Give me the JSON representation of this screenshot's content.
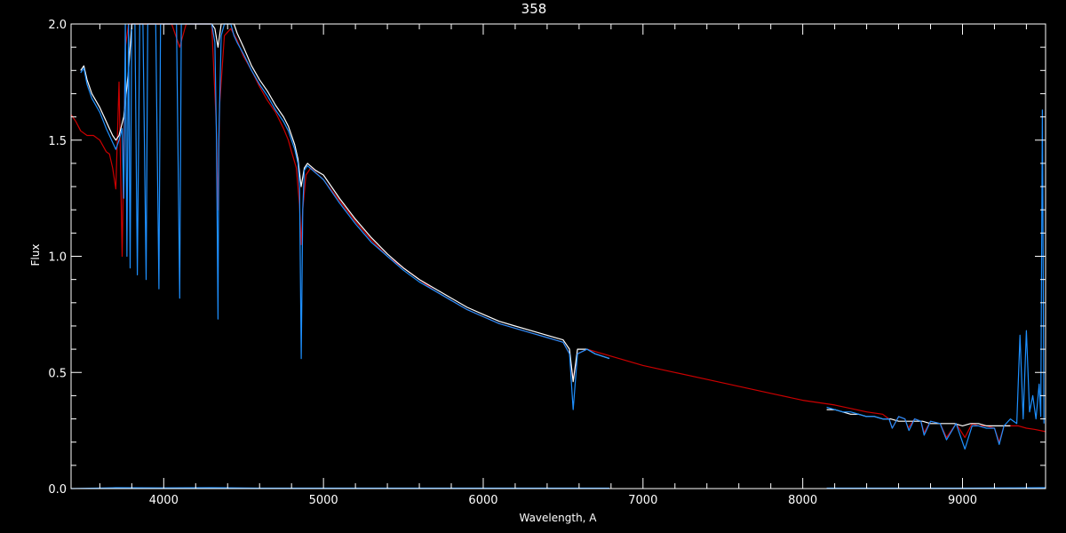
{
  "chart_data": {
    "type": "line",
    "title": "358",
    "xlabel": "Wavelength, A",
    "ylabel": "Flux",
    "xlim": [
      3420,
      9520
    ],
    "ylim": [
      0.0,
      2.0
    ],
    "grid": false,
    "x_ticks": [
      {
        "value": 4000,
        "label": "4000"
      },
      {
        "value": 5000,
        "label": "5000"
      },
      {
        "value": 6000,
        "label": "6000"
      },
      {
        "value": 7000,
        "label": "7000"
      },
      {
        "value": 8000,
        "label": "8000"
      },
      {
        "value": 9000,
        "label": "9000"
      }
    ],
    "y_ticks": [
      {
        "value": 0.0,
        "label": "0.0"
      },
      {
        "value": 0.5,
        "label": "0.5"
      },
      {
        "value": 1.0,
        "label": "1.0"
      },
      {
        "value": 1.5,
        "label": "1.5"
      },
      {
        "value": 2.0,
        "label": "2.0"
      }
    ],
    "colors": {
      "axes": "#ffffff",
      "observed": "#ffffff",
      "corrected": "#1e90ff",
      "model": "#cc0000",
      "error": "#1e90ff"
    },
    "series": [
      {
        "color": "#cc0000",
        "x": [
          3420,
          3450,
          3480,
          3520,
          3560,
          3600,
          3640,
          3660,
          3680,
          3700,
          3720,
          3740,
          3760,
          3780,
          3800,
          3830,
          3850,
          3880,
          3900,
          3940,
          3970,
          3990,
          4010,
          4050,
          4100,
          4140,
          4200,
          4260,
          4300,
          4330,
          4340,
          4350,
          4380,
          4420,
          4460,
          4500,
          4550,
          4600,
          4650,
          4700,
          4750,
          4780,
          4800,
          4830,
          4850,
          4860,
          4870,
          4890,
          4920,
          5000,
          5100,
          5200,
          5300,
          5400,
          5500,
          5600,
          5700,
          5800,
          5900,
          6000,
          6100,
          6200,
          6300,
          6400,
          6500,
          6540,
          6563,
          6590,
          6650,
          6800,
          7000,
          7200,
          7400,
          7600,
          7800,
          8000,
          8200,
          8400,
          8500,
          8540,
          8560,
          8600,
          8640,
          8660,
          8700,
          8740,
          8760,
          8800,
          8860,
          8900,
          8960,
          9015,
          9060,
          9100,
          9150,
          9200,
          9230,
          9260,
          9300,
          9350,
          9400,
          9450,
          9520
        ],
        "values": [
          1.61,
          1.58,
          1.54,
          1.52,
          1.52,
          1.5,
          1.45,
          1.44,
          1.38,
          1.29,
          1.75,
          1.0,
          1.9,
          2.0,
          2.0,
          2.0,
          2.0,
          2.0,
          2.0,
          2.0,
          2.0,
          2.0,
          2.0,
          2.0,
          1.9,
          2.0,
          2.0,
          2.0,
          2.0,
          1.55,
          1.2,
          1.65,
          1.95,
          1.98,
          1.93,
          1.86,
          1.8,
          1.73,
          1.67,
          1.62,
          1.55,
          1.5,
          1.45,
          1.38,
          1.22,
          1.05,
          1.2,
          1.35,
          1.38,
          1.33,
          1.24,
          1.15,
          1.07,
          1.0,
          0.95,
          0.9,
          0.85,
          0.81,
          0.77,
          0.74,
          0.71,
          0.69,
          0.67,
          0.65,
          0.63,
          0.58,
          0.47,
          0.58,
          0.6,
          0.57,
          0.53,
          0.5,
          0.47,
          0.44,
          0.41,
          0.38,
          0.36,
          0.33,
          0.32,
          0.3,
          0.26,
          0.31,
          0.3,
          0.26,
          0.3,
          0.29,
          0.24,
          0.29,
          0.28,
          0.22,
          0.28,
          0.22,
          0.28,
          0.27,
          0.27,
          0.26,
          0.2,
          0.27,
          0.27,
          0.27,
          0.26,
          0.255,
          0.245
        ]
      },
      {
        "color": "#ffffff",
        "x": [
          3480,
          3500,
          3520,
          3550,
          3600,
          3640,
          3660,
          3680,
          3700,
          3720,
          3750,
          3780,
          3800,
          3850,
          3900,
          3950,
          4000,
          4050,
          4100,
          4150,
          4200,
          4250,
          4280,
          4300,
          4320,
          4340,
          4360,
          4380,
          4400,
          4420,
          4440,
          4460,
          4500,
          4550,
          4600,
          4650,
          4700,
          4750,
          4780,
          4800,
          4820,
          4840,
          4860,
          4880,
          4900,
          4950,
          5000,
          5100,
          5200,
          5300,
          5400,
          5500,
          5600,
          5700,
          5800,
          5900,
          6000,
          6100,
          6200,
          6300,
          6400,
          6500,
          6540,
          6563,
          6590,
          6650,
          6700,
          6790
        ],
        "values": [
          1.8,
          1.82,
          1.76,
          1.7,
          1.64,
          1.58,
          1.55,
          1.52,
          1.5,
          1.52,
          1.6,
          1.8,
          2.0,
          2.0,
          2.0,
          2.0,
          2.0,
          2.0,
          2.0,
          2.0,
          2.0,
          2.0,
          2.0,
          2.0,
          1.98,
          1.9,
          2.0,
          2.05,
          2.1,
          2.05,
          2.0,
          1.96,
          1.9,
          1.82,
          1.76,
          1.71,
          1.65,
          1.6,
          1.56,
          1.52,
          1.48,
          1.42,
          1.3,
          1.38,
          1.4,
          1.37,
          1.35,
          1.25,
          1.16,
          1.08,
          1.01,
          0.95,
          0.9,
          0.86,
          0.82,
          0.78,
          0.75,
          0.72,
          0.7,
          0.68,
          0.66,
          0.64,
          0.6,
          0.46,
          0.6,
          0.6,
          0.58,
          0.56
        ]
      },
      {
        "color": "#1e90ff",
        "x": [
          3480,
          3500,
          3520,
          3550,
          3600,
          3640,
          3660,
          3680,
          3700,
          3720,
          3740,
          3750,
          3760,
          3770,
          3780,
          3790,
          3800,
          3820,
          3835,
          3850,
          3870,
          3890,
          3900,
          3920,
          3950,
          3970,
          3980,
          4000,
          4050,
          4080,
          4100,
          4110,
          4150,
          4200,
          4250,
          4280,
          4300,
          4320,
          4330,
          4340,
          4345,
          4360,
          4380,
          4400,
          4420,
          4440,
          4460,
          4500,
          4550,
          4600,
          4650,
          4700,
          4750,
          4780,
          4800,
          4820,
          4840,
          4850,
          4861,
          4870,
          4880,
          4900,
          4950,
          5000,
          5100,
          5200,
          5300,
          5400,
          5500,
          5600,
          5700,
          5800,
          5900,
          6000,
          6100,
          6200,
          6300,
          6400,
          6500,
          6540,
          6563,
          6590,
          6650,
          6700,
          6790
        ],
        "values": [
          1.79,
          1.81,
          1.74,
          1.68,
          1.62,
          1.55,
          1.52,
          1.49,
          1.46,
          1.5,
          1.55,
          1.25,
          2.0,
          1.0,
          2.0,
          0.95,
          2.0,
          2.0,
          0.92,
          2.0,
          2.0,
          0.9,
          2.0,
          2.0,
          2.0,
          0.86,
          2.0,
          2.0,
          2.0,
          2.0,
          0.82,
          2.0,
          2.0,
          2.0,
          2.0,
          2.0,
          2.0,
          1.92,
          1.5,
          0.73,
          1.5,
          1.95,
          2.0,
          2.05,
          2.0,
          1.95,
          1.92,
          1.87,
          1.8,
          1.74,
          1.69,
          1.63,
          1.58,
          1.54,
          1.5,
          1.46,
          1.4,
          1.3,
          0.56,
          1.2,
          1.37,
          1.39,
          1.36,
          1.33,
          1.23,
          1.14,
          1.06,
          1.0,
          0.94,
          0.89,
          0.85,
          0.81,
          0.77,
          0.74,
          0.71,
          0.69,
          0.67,
          0.65,
          0.63,
          0.58,
          0.34,
          0.58,
          0.6,
          0.58,
          0.56
        ]
      },
      {
        "color": "#ffffff",
        "x": [
          8150,
          8200,
          8250,
          8300,
          8350,
          8400,
          8450,
          8500,
          8550,
          8600,
          8650,
          8700,
          8750,
          8800,
          8850,
          8900,
          8950,
          9000,
          9050,
          9100,
          9150,
          9200,
          9250,
          9300
        ],
        "values": [
          0.34,
          0.34,
          0.33,
          0.32,
          0.32,
          0.31,
          0.31,
          0.3,
          0.3,
          0.29,
          0.29,
          0.29,
          0.29,
          0.28,
          0.28,
          0.28,
          0.28,
          0.27,
          0.28,
          0.28,
          0.27,
          0.27,
          0.27,
          0.27
        ]
      },
      {
        "color": "#1e90ff",
        "x": [
          8150,
          8200,
          8250,
          8300,
          8350,
          8400,
          8450,
          8500,
          8540,
          8560,
          8600,
          8640,
          8665,
          8700,
          8740,
          8760,
          8800,
          8860,
          8900,
          8960,
          9015,
          9060,
          9100,
          9150,
          9200,
          9230,
          9260,
          9300,
          9340,
          9360,
          9380,
          9400,
          9420,
          9440,
          9460,
          9480,
          9490,
          9500,
          9510
        ],
        "values": [
          0.35,
          0.34,
          0.33,
          0.33,
          0.32,
          0.31,
          0.31,
          0.3,
          0.3,
          0.26,
          0.31,
          0.3,
          0.25,
          0.3,
          0.29,
          0.23,
          0.29,
          0.28,
          0.21,
          0.28,
          0.17,
          0.27,
          0.27,
          0.26,
          0.26,
          0.19,
          0.27,
          0.3,
          0.28,
          0.66,
          0.3,
          0.68,
          0.33,
          0.4,
          0.3,
          0.45,
          0.31,
          1.63,
          0.28
        ]
      },
      {
        "color": "#1e90ff",
        "x": [
          3420,
          3700,
          4000,
          4300,
          4600,
          5000,
          5500,
          6000,
          6500,
          6790
        ],
        "values": [
          0.0,
          0.004,
          0.003,
          0.004,
          0.002,
          0.002,
          0.002,
          0.002,
          0.002,
          0.002
        ]
      },
      {
        "color": "#1e90ff",
        "x": [
          8150,
          8500,
          9000,
          9300,
          9520
        ],
        "values": [
          0.002,
          0.002,
          0.002,
          0.003,
          0.004
        ]
      }
    ]
  }
}
